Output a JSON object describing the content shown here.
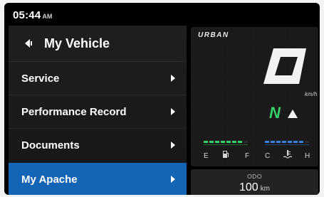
{
  "status": {
    "time": "05:44",
    "ampm": "AM"
  },
  "menu": {
    "title": "My Vehicle",
    "items": [
      {
        "label": "Service"
      },
      {
        "label": "Performance Record"
      },
      {
        "label": "Documents"
      },
      {
        "label": "My Apache",
        "selected": true
      }
    ]
  },
  "dashboard": {
    "mode": "URBAN",
    "speed": "0",
    "speed_unit": "km/h",
    "gear": "N",
    "fuel_left": "E",
    "fuel_right": "F",
    "temp_left": "C",
    "temp_right": "H",
    "fuel_icon": "fuel-pump-icon",
    "temp_icon": "coolant-temperature-icon",
    "fuel_color": "#35d06a",
    "temp_color": "#3a7fe0"
  },
  "odo": {
    "label": "ODO",
    "value": "100",
    "unit": "km"
  },
  "colors": {
    "selected": "#1565b6",
    "gear": "#35d06a"
  }
}
